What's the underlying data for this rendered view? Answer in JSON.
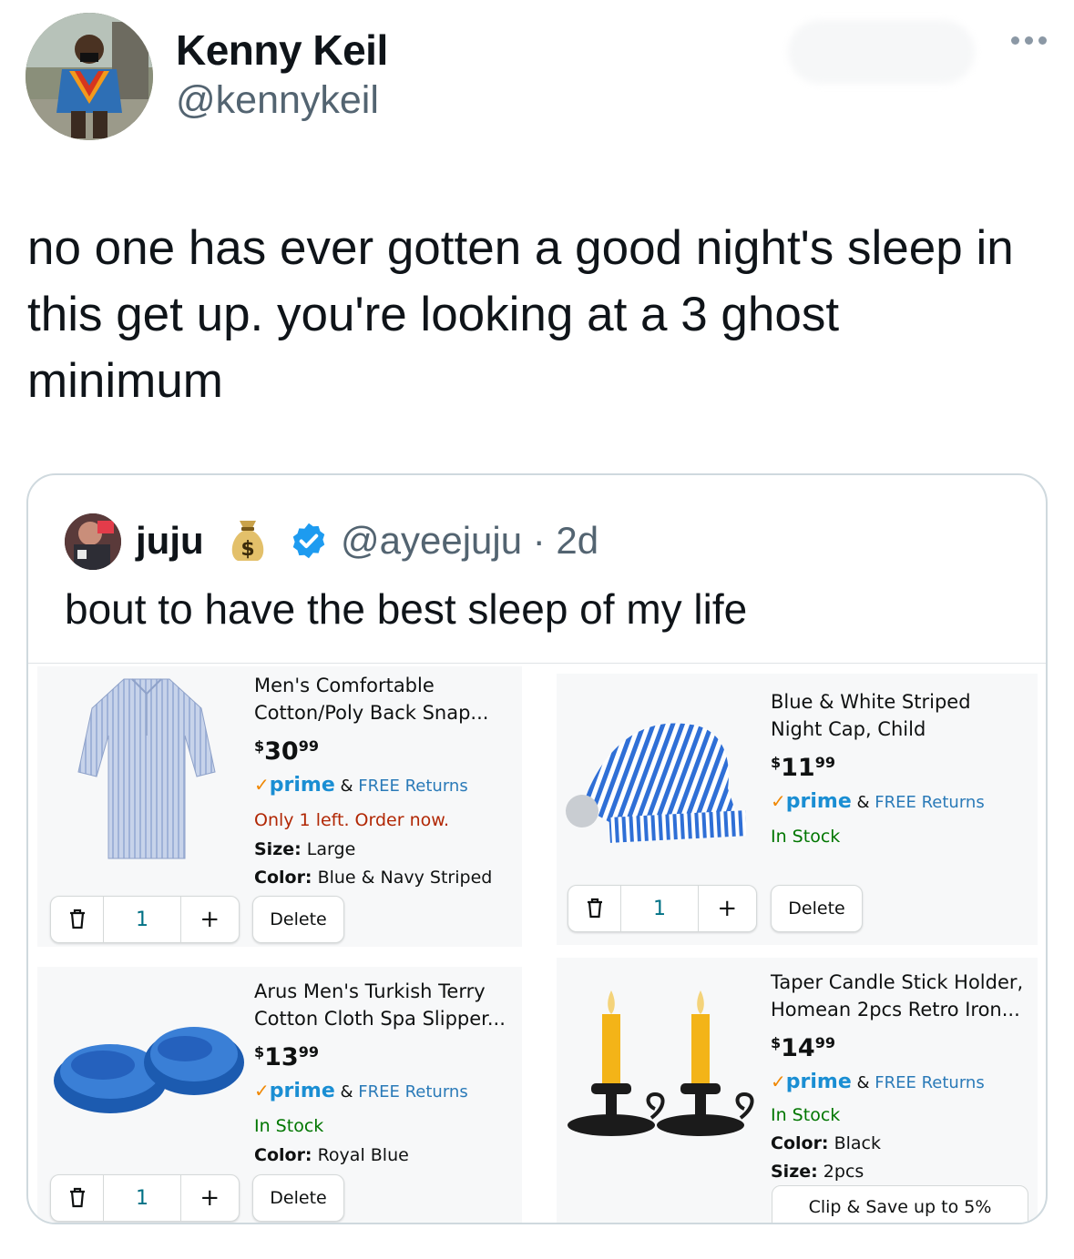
{
  "tweet": {
    "author_name": "Kenny Keil",
    "author_handle": "@kennykeil",
    "text": "no one has ever gotten a good night's sleep in this get up. you're looking at a 3 ghost minimum"
  },
  "quoted_tweet": {
    "name": "juju",
    "handle_time": "@ayeejuju · 2d",
    "text": "bout to have the best sleep of my life",
    "icons": [
      "money-bag-emoji",
      "verified-badge"
    ]
  },
  "products": [
    {
      "title": "Men's Comfortable Cotton/Poly Back Snap...",
      "price_currency": "$",
      "price_whole": "30",
      "price_cents": "99",
      "prime_word": "prime",
      "prime_amp": "&",
      "prime_returns": "FREE Returns",
      "stock": "Only 1 left. Order now.",
      "attr1_label": "Size:",
      "attr1_value": "Large",
      "attr2_label": "Color:",
      "attr2_value": "Blue & Navy Striped",
      "quantity": "1",
      "delete_label": "Delete",
      "image": "nightshirt"
    },
    {
      "title": "Blue & White Striped Night Cap, Child",
      "price_currency": "$",
      "price_whole": "11",
      "price_cents": "99",
      "prime_word": "prime",
      "prime_amp": "&",
      "prime_returns": "FREE Returns",
      "stock": "In Stock",
      "quantity": "1",
      "delete_label": "Delete",
      "image": "striped-night-cap"
    },
    {
      "title": "Arus Men's Turkish Terry Cotton Cloth Spa Slipper...",
      "price_currency": "$",
      "price_whole": "13",
      "price_cents": "99",
      "prime_word": "prime",
      "prime_amp": "&",
      "prime_returns": "FREE Returns",
      "stock": "In Stock",
      "attr1_label": "Color:",
      "attr1_value": "Royal Blue",
      "quantity": "1",
      "delete_label": "Delete",
      "image": "blue-slippers"
    },
    {
      "title": "Taper Candle Stick Holder, Homean 2pcs Retro Iron...",
      "price_currency": "$",
      "price_whole": "14",
      "price_cents": "99",
      "prime_word": "prime",
      "prime_amp": "&",
      "prime_returns": "FREE Returns",
      "stock": "In Stock",
      "attr1_label": "Color:",
      "attr1_value": "Black",
      "attr2_label": "Size:",
      "attr2_value": "2pcs",
      "clip_label": "Clip & Save up to 5%",
      "image": "candle-holders"
    }
  ],
  "colors": {
    "prime_blue": "#1a8ed3",
    "prime_check": "#f08804",
    "stock_green": "#007600",
    "stock_red": "#b12704",
    "qty_teal": "#007185",
    "verified_blue": "#1d9bf0"
  }
}
